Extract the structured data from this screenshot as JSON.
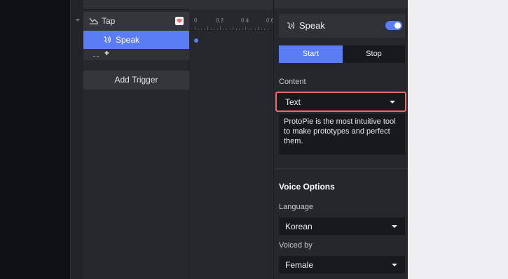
{
  "tree": {
    "trigger_label": "Tap",
    "response_label": "Speak",
    "add_response_label": "+",
    "add_trigger_label": "Add Trigger"
  },
  "timeline": {
    "ticks": [
      "0",
      "0.2",
      "0.4",
      "0.6"
    ]
  },
  "props": {
    "response_title": "Speak",
    "toggle_on": true,
    "segment": {
      "start": "Start",
      "stop": "Stop",
      "selected": "Start"
    },
    "content": {
      "label": "Content",
      "dropdown_value": "Text",
      "text_value": "ProtoPie is the most intuitive tool to make prototypes and perfect them."
    },
    "voice_options": {
      "title": "Voice Options",
      "language_label": "Language",
      "language_value": "Korean",
      "voiced_by_label": "Voiced by",
      "voiced_by_value": "Female"
    }
  },
  "colors": {
    "accent": "#5a7cf5",
    "highlight_border": "#ef6b6b",
    "panel_bg": "#25272c",
    "field_bg": "#18191c"
  }
}
